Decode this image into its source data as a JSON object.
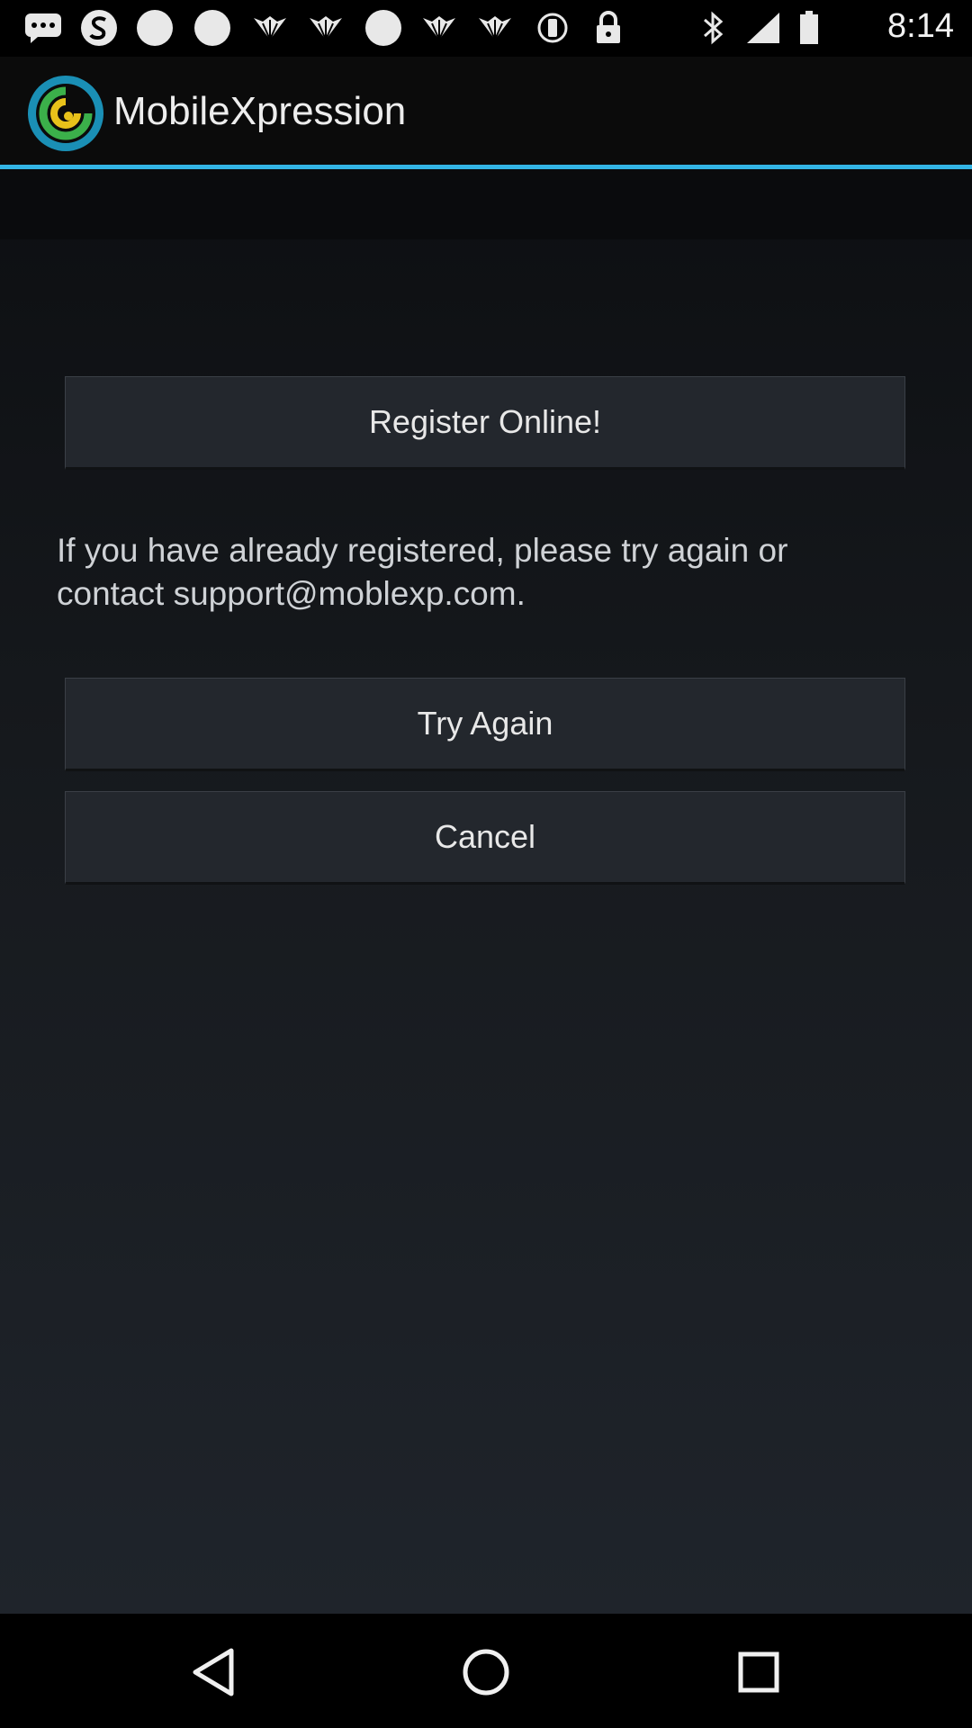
{
  "status_bar": {
    "time": "8:14",
    "icons": [
      "chat-bubble-icon",
      "app-s-icon",
      "dot-icon",
      "dot-icon",
      "wings-icon",
      "wings-icon",
      "dot-icon",
      "wings-icon",
      "wings-icon",
      "vibrate-icon",
      "lock-icon",
      "bluetooth-icon",
      "signal-icon",
      "battery-icon"
    ]
  },
  "app_bar": {
    "title": "MobileXpression",
    "logo": "mobilexpression-logo"
  },
  "dialog": {
    "register_label": "Register Online!",
    "message": "If you have already registered, please try again or contact support@moblexp.com.",
    "try_again_label": "Try Again",
    "cancel_label": "Cancel"
  },
  "colors": {
    "accent": "#33b5e5",
    "button_bg": "#23272d",
    "background": "#1f242b"
  },
  "nav_bar": {
    "buttons": [
      "back-icon",
      "home-icon",
      "recents-icon"
    ]
  }
}
